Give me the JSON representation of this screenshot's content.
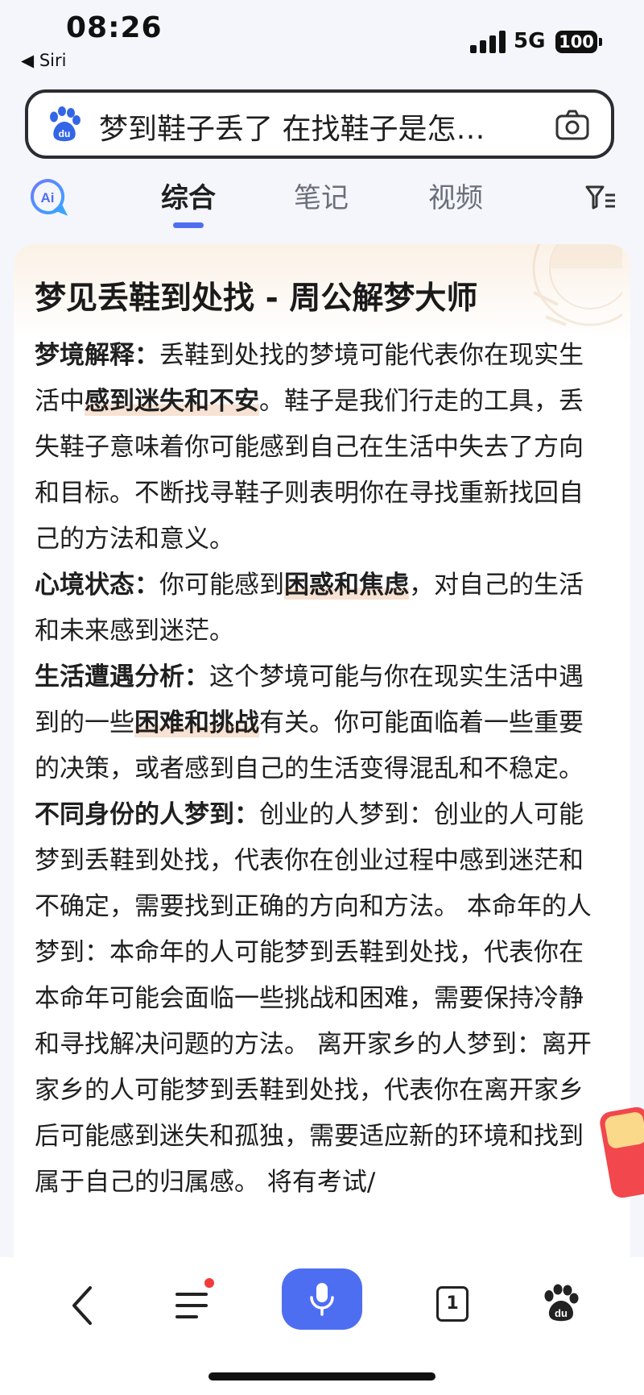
{
  "status_bar": {
    "time": "08:26",
    "back_app": "◀ Siri",
    "network": "5G",
    "battery": "100"
  },
  "search": {
    "query": "梦到鞋子丢了 在找鞋子是怎…",
    "logo_icon": "baidu-paw-icon",
    "camera_icon": "camera-icon"
  },
  "tabs": [
    {
      "label": "综合",
      "active": true
    },
    {
      "label": "笔记",
      "active": false
    },
    {
      "label": "视频",
      "active": false
    }
  ],
  "card": {
    "title": "梦见丢鞋到处找 - 周公解梦大师",
    "sections": [
      {
        "heading": "梦境解释：",
        "parts": [
          "丢鞋到处找的梦境可能代表你在现实生活中",
          "感到迷失和不安",
          "。鞋子是我们行走的工具，丢失鞋子意味着你可能感到自己在生活中失去了方向和目标。不断找寻鞋子则表明你在寻找重新找回自己的方法和意义。"
        ]
      },
      {
        "heading": "心境状态：",
        "parts": [
          "你可能感到",
          "困惑和焦虑",
          "，对自己的生活和未来感到迷茫。"
        ]
      },
      {
        "heading": "生活遭遇分析：",
        "parts": [
          "这个梦境可能与你在现实生活中遇到的一些",
          "困难和挑战",
          "有关。你可能面临着一些重要的决策，或者感到自己的生活变得混乱和不稳定。"
        ]
      },
      {
        "heading": "不同身份的人梦到：",
        "parts": [
          "创业的人梦到：创业的人可能梦到丢鞋到处找，代表你在创业过程中感到迷茫和不确定，需要找到正确的方向和方法。 本命年的人梦到：本命年的人可能梦到丢鞋到处找，代表你在本命年可能会面临一些挑战和困难，需要保持冷静和寻找解决问题的方法。 离开家乡的人梦到：离开家乡的人可能梦到丢鞋到处找，代表你在离开家乡后可能感到迷失和孤独，需要适应新的环境和找到属于自己的归属感。 将有考试/",
          "",
          ""
        ]
      }
    ]
  },
  "bottom_bar": {
    "tab_count": "1"
  },
  "colors": {
    "accent": "#4e6ef2",
    "highlight": "#f7e2d3",
    "notification_dot": "#f23a3a"
  }
}
